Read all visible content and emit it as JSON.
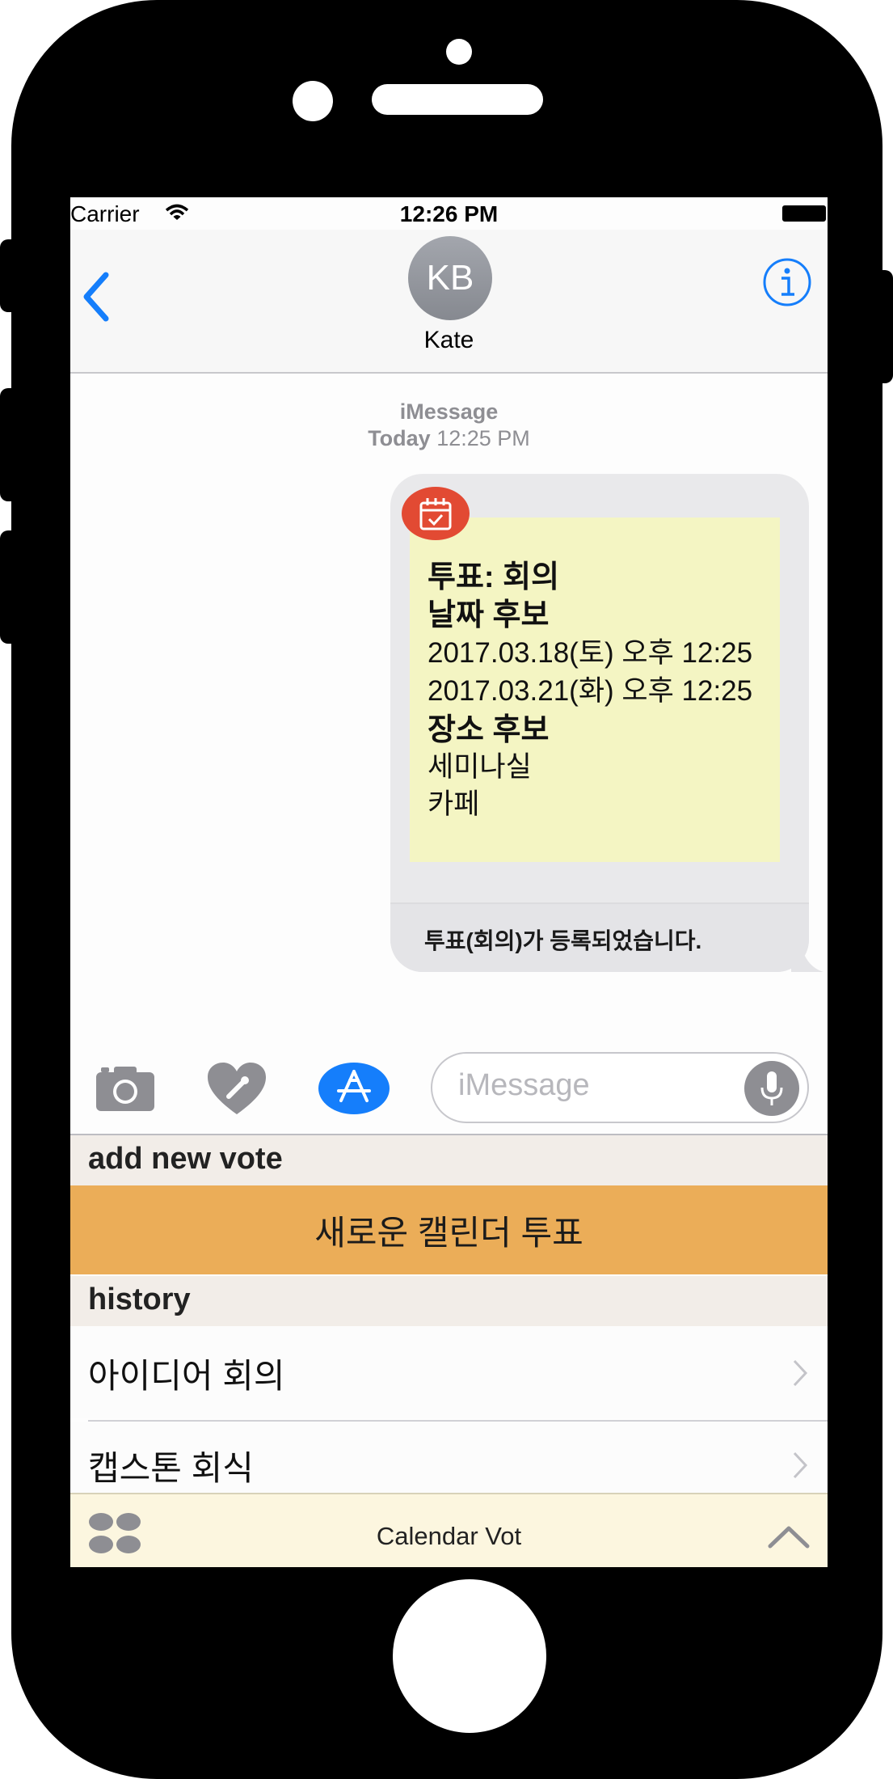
{
  "status_bar": {
    "carrier": "Carrier",
    "time": "12:26 PM"
  },
  "nav": {
    "contact_initials": "KB",
    "contact_name": "Kate"
  },
  "conversation": {
    "service": "iMessage",
    "date_label": "Today",
    "time_label": "12:25 PM",
    "message": {
      "title_line": "투표: 회의",
      "date_header": "날짜 후보",
      "date_options": [
        "2017.03.18(토) 오후 12:25",
        "2017.03.21(화) 오후 12:25"
      ],
      "place_header": "장소 후보",
      "place_options": [
        "세미나실",
        "카페"
      ],
      "caption": "투표(회의)가 등록되었습니다."
    }
  },
  "composer": {
    "placeholder": "iMessage"
  },
  "extension": {
    "add_section_title": "add new vote",
    "new_vote_label": "새로운 캘린더 투표",
    "history_section_title": "history",
    "history_items": [
      "아이디어 회의",
      "캡스톤 회식"
    ],
    "app_name": "Calendar Vot"
  },
  "colors": {
    "ios_blue": "#157efb",
    "vote_button": "#ebad58",
    "card_background": "#f4f5c3",
    "app_icon_red": "#e24a33"
  },
  "icons": [
    "back-chevron-icon",
    "info-icon",
    "camera-icon",
    "digital-touch-heart-icon",
    "app-store-icon",
    "microphone-icon",
    "apps-grid-icon",
    "chevron-up-icon",
    "chevron-right-icon",
    "wifi-icon",
    "battery-icon",
    "calendar-icon"
  ]
}
